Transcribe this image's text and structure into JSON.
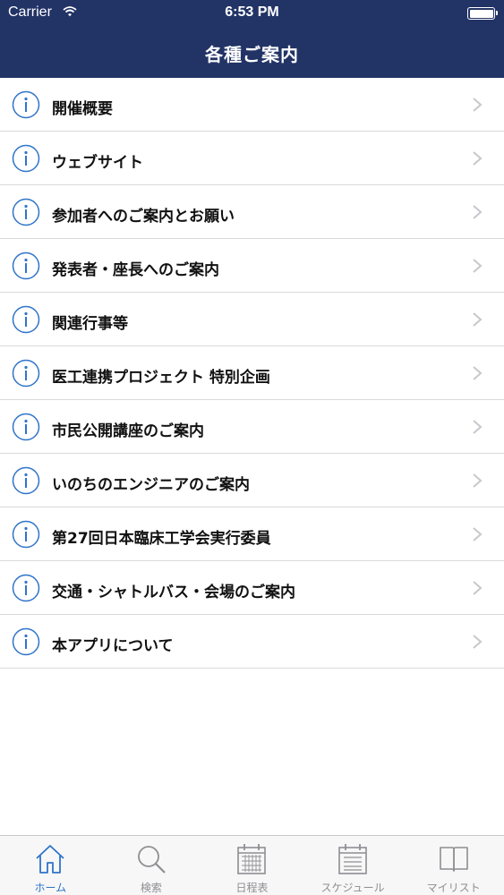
{
  "status_bar": {
    "carrier": "Carrier",
    "time": "6:53 PM"
  },
  "header": {
    "title": "各種ご案内"
  },
  "colors": {
    "header_bg": "#223366",
    "accent": "#2f74c9",
    "inactive": "#8e8e93"
  },
  "items": [
    {
      "label": "開催概要",
      "icon": "info-icon"
    },
    {
      "label": "ウェブサイト",
      "icon": "info-icon"
    },
    {
      "label": "参加者へのご案内とお願い",
      "icon": "info-icon"
    },
    {
      "label": "発表者・座長へのご案内",
      "icon": "info-icon"
    },
    {
      "label": "関連行事等",
      "icon": "info-icon"
    },
    {
      "label": "医工連携プロジェクト 特別企画",
      "icon": "info-icon"
    },
    {
      "label": "市民公開講座のご案内",
      "icon": "info-icon"
    },
    {
      "label": "いのちのエンジニアのご案内",
      "icon": "info-icon"
    },
    {
      "label": "第27回日本臨床工学会実行委員",
      "icon": "info-icon"
    },
    {
      "label": "交通・シャトルバス・会場のご案内",
      "icon": "info-icon"
    },
    {
      "label": "本アプリについて",
      "icon": "info-icon"
    }
  ],
  "tabs": [
    {
      "label": "ホーム",
      "icon": "home-icon",
      "active": true
    },
    {
      "label": "検索",
      "icon": "search-icon",
      "active": false
    },
    {
      "label": "日程表",
      "icon": "calendar-icon",
      "active": false
    },
    {
      "label": "スケジュール",
      "icon": "schedule-icon",
      "active": false
    },
    {
      "label": "マイリスト",
      "icon": "book-icon",
      "active": false
    }
  ]
}
